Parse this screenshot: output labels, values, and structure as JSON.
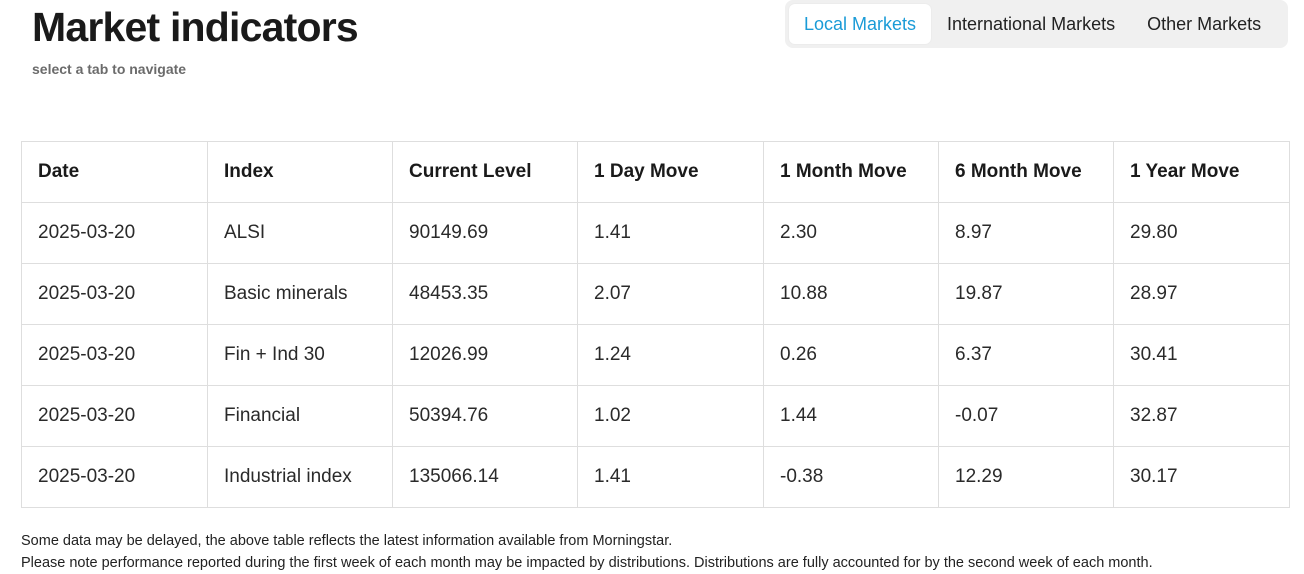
{
  "header": {
    "title": "Market indicators",
    "subtitle": "select a tab to navigate"
  },
  "tabs": [
    {
      "label": "Local Markets",
      "active": true
    },
    {
      "label": "International Markets",
      "active": false
    },
    {
      "label": "Other Markets",
      "active": false
    }
  ],
  "table": {
    "columns": [
      "Date",
      "Index",
      "Current Level",
      "1 Day Move",
      "1 Month Move",
      "6 Month Move",
      "1 Year Move"
    ],
    "rows": [
      [
        "2025-03-20",
        "ALSI",
        "90149.69",
        "1.41",
        "2.30",
        "8.97",
        "29.80"
      ],
      [
        "2025-03-20",
        "Basic minerals",
        "48453.35",
        "2.07",
        "10.88",
        "19.87",
        "28.97"
      ],
      [
        "2025-03-20",
        "Fin + Ind 30",
        "12026.99",
        "1.24",
        "0.26",
        "6.37",
        "30.41"
      ],
      [
        "2025-03-20",
        "Financial",
        "50394.76",
        "1.02",
        "1.44",
        "-0.07",
        "32.87"
      ],
      [
        "2025-03-20",
        "Industrial index",
        "135066.14",
        "1.41",
        "-0.38",
        "12.29",
        "30.17"
      ]
    ]
  },
  "notes": [
    "Some data may be delayed, the above table reflects the latest information available from Morningstar.",
    "Please note performance reported during the first week of each month may be impacted by distributions. Distributions are fully accounted for by the second week of each month."
  ],
  "colors": {
    "accent": "#1a9bd7",
    "tab_bar_bg": "#f0f0f0",
    "border": "#dedede"
  }
}
